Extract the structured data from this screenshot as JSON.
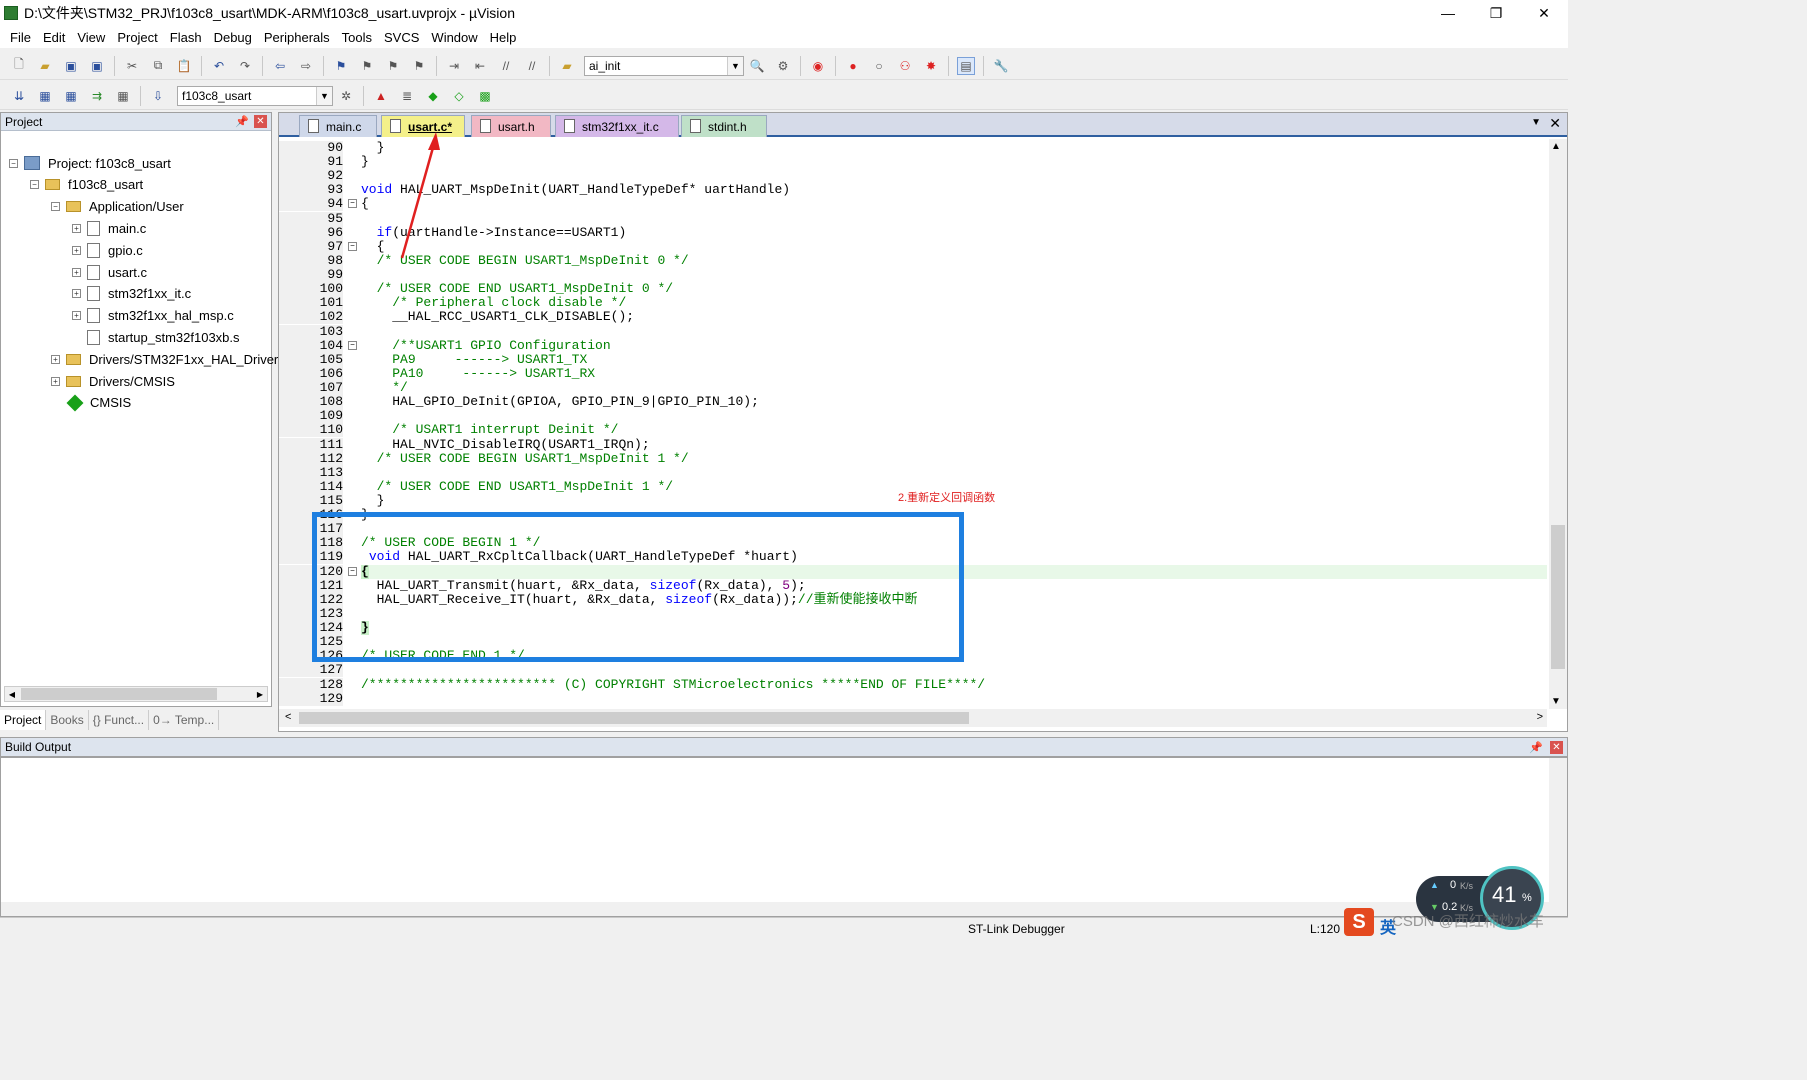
{
  "window": {
    "title": "D:\\文件夹\\STM32_PRJ\\f103c8_usart\\MDK-ARM\\f103c8_usart.uvprojx - µVision",
    "minimize": "—",
    "restore": "❐",
    "close": "✕"
  },
  "menu": [
    "File",
    "Edit",
    "View",
    "Project",
    "Flash",
    "Debug",
    "Peripherals",
    "Tools",
    "SVCS",
    "Window",
    "Help"
  ],
  "toolbar1": {
    "find_combo": "ai_init"
  },
  "toolbar2": {
    "target_combo": "f103c8_usart"
  },
  "project_panel": {
    "title": "Project",
    "tree": [
      {
        "label": "Project: f103c8_usart",
        "level": 0,
        "icon": "project-icon",
        "expander": "−"
      },
      {
        "label": "f103c8_usart",
        "level": 1,
        "icon": "target-icon",
        "expander": "−"
      },
      {
        "label": "Application/User",
        "level": 2,
        "icon": "folder-icon",
        "expander": "−"
      },
      {
        "label": "main.c",
        "level": 3,
        "icon": "file-icon",
        "expander": "+"
      },
      {
        "label": "gpio.c",
        "level": 3,
        "icon": "file-icon",
        "expander": "+"
      },
      {
        "label": "usart.c",
        "level": 3,
        "icon": "file-icon",
        "expander": "+"
      },
      {
        "label": "stm32f1xx_it.c",
        "level": 3,
        "icon": "file-icon",
        "expander": "+"
      },
      {
        "label": "stm32f1xx_hal_msp.c",
        "level": 3,
        "icon": "file-icon",
        "expander": "+"
      },
      {
        "label": "startup_stm32f103xb.s",
        "level": 3,
        "icon": "file-icon",
        "expander": ""
      },
      {
        "label": "Drivers/STM32F1xx_HAL_Driver",
        "level": 2,
        "icon": "folder-icon",
        "expander": "+"
      },
      {
        "label": "Drivers/CMSIS",
        "level": 2,
        "icon": "folder-icon",
        "expander": "+"
      },
      {
        "label": "CMSIS",
        "level": 2,
        "icon": "diamond-icon",
        "expander": ""
      }
    ],
    "bottom_tabs": [
      "Project",
      "Books",
      "{} Funct...",
      "0→ Temp..."
    ]
  },
  "editor_tabs": [
    {
      "label": "main.c",
      "active": false,
      "color": "#cfd8ea"
    },
    {
      "label": "usart.c*",
      "active": true,
      "color": "#f4f08a"
    },
    {
      "label": "usart.h",
      "active": false,
      "color": "#f2b8c4"
    },
    {
      "label": "stm32f1xx_it.c",
      "active": false,
      "color": "#d4b8e8"
    },
    {
      "label": "stdint.h",
      "active": false,
      "color": "#bfe0c8"
    }
  ],
  "code_lines": [
    {
      "n": "90",
      "fold": "",
      "html": "  }"
    },
    {
      "n": "91",
      "fold": "",
      "html": "}"
    },
    {
      "n": "92",
      "fold": "",
      "html": ""
    },
    {
      "n": "93",
      "fold": "",
      "html": "<span class='kw'>void</span> HAL_UART_MspDeInit(UART_HandleTypeDef* uartHandle)"
    },
    {
      "n": "94",
      "fold": "−",
      "html": "{"
    },
    {
      "n": "95",
      "fold": "",
      "html": ""
    },
    {
      "n": "96",
      "fold": "",
      "html": "  <span class='kw'>if</span>(uartHandle->Instance==USART1)"
    },
    {
      "n": "97",
      "fold": "−",
      "html": "  {"
    },
    {
      "n": "98",
      "fold": "",
      "html": "  <span class='cmt'>/* USER CODE BEGIN USART1_MspDeInit 0 */</span>"
    },
    {
      "n": "99",
      "fold": "",
      "html": ""
    },
    {
      "n": "100",
      "fold": "",
      "html": "  <span class='cmt'>/* USER CODE END USART1_MspDeInit 0 */</span>"
    },
    {
      "n": "101",
      "fold": "",
      "html": "    <span class='cmt'>/* Peripheral clock disable */</span>"
    },
    {
      "n": "102",
      "fold": "",
      "html": "    __HAL_RCC_USART1_CLK_DISABLE();"
    },
    {
      "n": "103",
      "fold": "",
      "html": ""
    },
    {
      "n": "104",
      "fold": "−",
      "html": "    <span class='cmt'>/**USART1 GPIO Configuration</span>"
    },
    {
      "n": "105",
      "fold": "",
      "html": "    <span class='cmt'>PA9     ------&gt; USART1_TX</span>"
    },
    {
      "n": "106",
      "fold": "",
      "html": "    <span class='cmt'>PA10     ------&gt; USART1_RX</span>"
    },
    {
      "n": "107",
      "fold": "",
      "html": "    <span class='cmt'>*/</span>"
    },
    {
      "n": "108",
      "fold": "",
      "html": "    HAL_GPIO_DeInit(GPIOA, GPIO_PIN_9|GPIO_PIN_10);"
    },
    {
      "n": "109",
      "fold": "",
      "html": ""
    },
    {
      "n": "110",
      "fold": "",
      "html": "    <span class='cmt'>/* USART1 interrupt Deinit */</span>"
    },
    {
      "n": "111",
      "fold": "",
      "html": "    HAL_NVIC_DisableIRQ(USART1_IRQn);"
    },
    {
      "n": "112",
      "fold": "",
      "html": "  <span class='cmt'>/* USER CODE BEGIN USART1_MspDeInit 1 */</span>"
    },
    {
      "n": "113",
      "fold": "",
      "html": ""
    },
    {
      "n": "114",
      "fold": "",
      "html": "  <span class='cmt'>/* USER CODE END USART1_MspDeInit 1 */</span>"
    },
    {
      "n": "115",
      "fold": "",
      "html": "  }"
    },
    {
      "n": "116",
      "fold": "",
      "html": "}"
    },
    {
      "n": "117",
      "fold": "",
      "html": ""
    },
    {
      "n": "118",
      "fold": "",
      "html": "<span class='cmt'>/* USER CODE BEGIN 1 */</span>"
    },
    {
      "n": "119",
      "fold": "",
      "html": " <span class='kw'>void</span> HAL_UART_RxCpltCallback(UART_HandleTypeDef *huart)"
    },
    {
      "n": "120",
      "fold": "−",
      "html": "{"
    },
    {
      "n": "121",
      "fold": "",
      "html": "  HAL_UART_Transmit(huart, &amp;Rx_data, <span class='kw'>sizeof</span>(Rx_data), <span class='num'>5</span>);"
    },
    {
      "n": "122",
      "fold": "",
      "html": "  HAL_UART_Receive_IT(huart, &amp;Rx_data, <span class='kw'>sizeof</span>(Rx_data));<span class='cmt'>//重新使能接收中断</span>"
    },
    {
      "n": "123",
      "fold": "",
      "html": ""
    },
    {
      "n": "124",
      "fold": "",
      "html": "}"
    },
    {
      "n": "125",
      "fold": "",
      "html": ""
    },
    {
      "n": "126",
      "fold": "",
      "html": "<span class='cmt'>/* USER CODE END 1 */</span>"
    },
    {
      "n": "127",
      "fold": "",
      "html": ""
    },
    {
      "n": "128",
      "fold": "",
      "html": "<span class='cmt'>/************************ (C) COPYRIGHT STMicroelectronics *****END OF FILE****/</span>"
    },
    {
      "n": "129",
      "fold": "",
      "html": ""
    }
  ],
  "annotation": {
    "label": "2.重新定义回调函数",
    "color": "#e02020",
    "box_color": "#1e7fe0"
  },
  "build_output": {
    "title": "Build Output"
  },
  "status": {
    "debugger": "ST-Link Debugger",
    "position": "L:120 C"
  },
  "net_widget": {
    "up": "0",
    "up_unit": "K/s",
    "down": "0.2",
    "down_unit": "K/s",
    "percent": "41",
    "pct_sign": "%"
  },
  "watermark": {
    "ime": "英",
    "csdn": "CSDN @西红柿炒水车"
  }
}
